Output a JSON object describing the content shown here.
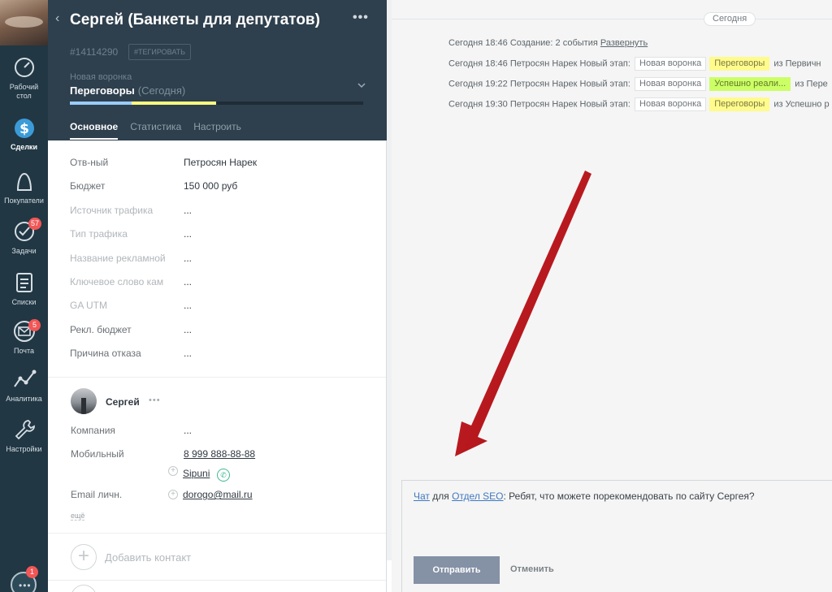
{
  "nav": {
    "items": [
      {
        "label_1": "Рабочий",
        "label_2": "стол"
      },
      {
        "label": "Сделки"
      },
      {
        "label": "Покупатели"
      },
      {
        "label": "Задачи",
        "badge": "57"
      },
      {
        "label": "Списки"
      },
      {
        "label": "Почта",
        "badge": "5"
      },
      {
        "label": "Аналитика"
      },
      {
        "label": "Настройки"
      }
    ],
    "chat_badge": "1"
  },
  "deal": {
    "back": "‹",
    "title": "Сергей (Банкеты для депутатов)",
    "menu": "•••",
    "id": "#14114290",
    "tag_button": "#ТЕГИРОВАТЬ",
    "pipeline": "Новая воронка",
    "stage": "Переговоры",
    "stage_date": "(Сегодня)",
    "progress": [
      {
        "fraction": 0.21,
        "color": "#99ccfe"
      },
      {
        "fraction": 0.29,
        "color": "#fffd7f"
      }
    ],
    "tabs": [
      "Основное",
      "Статистика",
      "Настроить"
    ],
    "fields": [
      {
        "label": "Отв-ный",
        "value": "Петросян Нарек",
        "muted": false
      },
      {
        "label": "Бюджет",
        "value": "150 000 руб",
        "muted": false
      },
      {
        "label": "Источник трафика",
        "value": "...",
        "muted": true
      },
      {
        "label": "Тип трафика",
        "value": "...",
        "muted": true
      },
      {
        "label": "Название рекламной",
        "value": "...",
        "muted": true
      },
      {
        "label": "Ключевое слово кам",
        "value": "...",
        "muted": true
      },
      {
        "label": "GA UTM",
        "value": "...",
        "muted": true
      },
      {
        "label": "Рекл. бюджет",
        "value": "...",
        "muted": false
      },
      {
        "label": "Причина отказа",
        "value": "...",
        "muted": false
      }
    ]
  },
  "contact": {
    "name": "Сергей",
    "menu": "•••",
    "company_label": "Компания",
    "company_value": "...",
    "mobile_label": "Мобильный",
    "mobile_value": "8 999 888-88-88",
    "sipuni": "Sipuni",
    "email_label": "Email личн.",
    "email_value": "dorogo@mail.ru",
    "more": "ещё",
    "add_contact": "Добавить контакт"
  },
  "feed": {
    "day": "Сегодня",
    "events": [
      {
        "time": "Сегодня 18:46",
        "text": "Создание: 2 события",
        "link": "Развернуть"
      },
      {
        "time": "Сегодня 18:46",
        "author": "Петросян Нарек",
        "action": "Новый этап:",
        "pipeline": "Новая воронка",
        "stage": "Переговоры",
        "stage_color": "yellow",
        "tail": "из Первичн"
      },
      {
        "time": "Сегодня 19:22",
        "author": "Петросян Нарек",
        "action": "Новый этап:",
        "pipeline": "Новая воронка",
        "stage": "Успешно реали...",
        "stage_color": "green",
        "tail": "из Пере"
      },
      {
        "time": "Сегодня 19:30",
        "author": "Петросян Нарек",
        "action": "Новый этап:",
        "pipeline": "Новая воронка",
        "stage": "Переговоры",
        "stage_color": "yellow",
        "tail": "из Успешно р"
      }
    ]
  },
  "composer": {
    "chat_link": "Чат",
    "for": "для",
    "dept_link": "Отдел SEO",
    "message": "Ребят,  что можете порекомендовать по сайту Сергея?",
    "send": "Отправить",
    "cancel": "Отменить"
  },
  "colors": {
    "nav_bg": "#213744",
    "header_bg": "#2e3f4d",
    "stage_yellow": "#fffb8c",
    "stage_green": "#ccff66",
    "arrow_red": "#c0141b",
    "send_button": "#8591a5"
  }
}
